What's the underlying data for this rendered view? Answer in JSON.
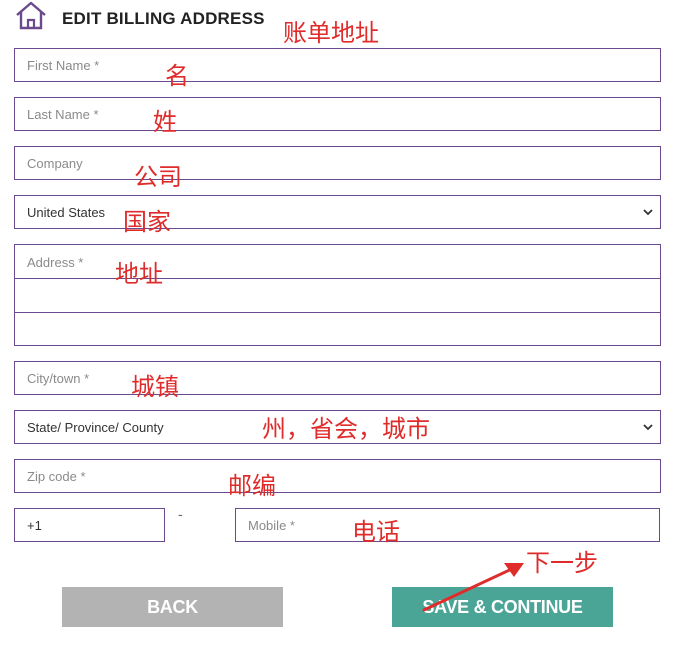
{
  "header": {
    "title": "EDIT BILLING ADDRESS",
    "icon": "home-icon"
  },
  "form": {
    "first_name_placeholder": "First Name *",
    "last_name_placeholder": "Last Name *",
    "company_placeholder": "Company",
    "country_value": "United States",
    "address_placeholder": "Address *",
    "city_placeholder": "City/town *",
    "state_value": "State/ Province/ County",
    "zip_placeholder": "Zip code *",
    "phone_code_value": "+1",
    "phone_separator": "-",
    "mobile_placeholder": "Mobile *"
  },
  "buttons": {
    "back_label": "BACK",
    "save_label": "SAVE & CONTINUE"
  },
  "annotations": {
    "title_note": "账单地址",
    "first_name_note": "名",
    "last_name_note": "姓",
    "company_note": "公司",
    "country_note": "国家",
    "address_note": "地址",
    "city_note": "城镇",
    "state_note": "州，省会，城市",
    "zip_note": "邮编",
    "mobile_note": "电话",
    "next_note": "下一步"
  },
  "colors": {
    "border": "#6a4a8c",
    "back_button": "#b3b3b3",
    "save_button": "#4aa597",
    "annotation": "#e02b2b"
  }
}
